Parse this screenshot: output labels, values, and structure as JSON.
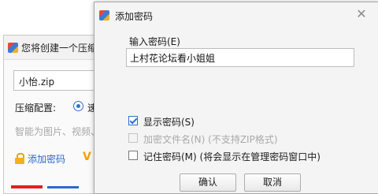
{
  "background_window": {
    "title": "您将创建一个压缩",
    "filename": "小怡.zip",
    "config_label": "压缩配置:",
    "radio_label": "速",
    "hint": "智能为图片、视频、",
    "add_password_link": "添加密码",
    "partial_icon": "V"
  },
  "dialog": {
    "title": "添加密码",
    "close_glyph": "✕",
    "password_label": "输入密码(E)",
    "password_value": "上村花论坛看小姐姐",
    "checkboxes": [
      {
        "label": "显示密码(S)",
        "checked": true,
        "enabled": true
      },
      {
        "label": "加密文件名(N) (不支持ZIP格式)",
        "checked": false,
        "enabled": false
      },
      {
        "label": "记住密码(M) (将会显示在管理密码窗口中)",
        "checked": false,
        "enabled": true
      }
    ],
    "ok_label": "确认",
    "cancel_label": "取消"
  },
  "colors": {
    "accent_blue": "#2f6fd6",
    "link_blue": "#2a6ad1",
    "red_edge": "#e02020",
    "disabled_text": "#a9a9a9"
  }
}
